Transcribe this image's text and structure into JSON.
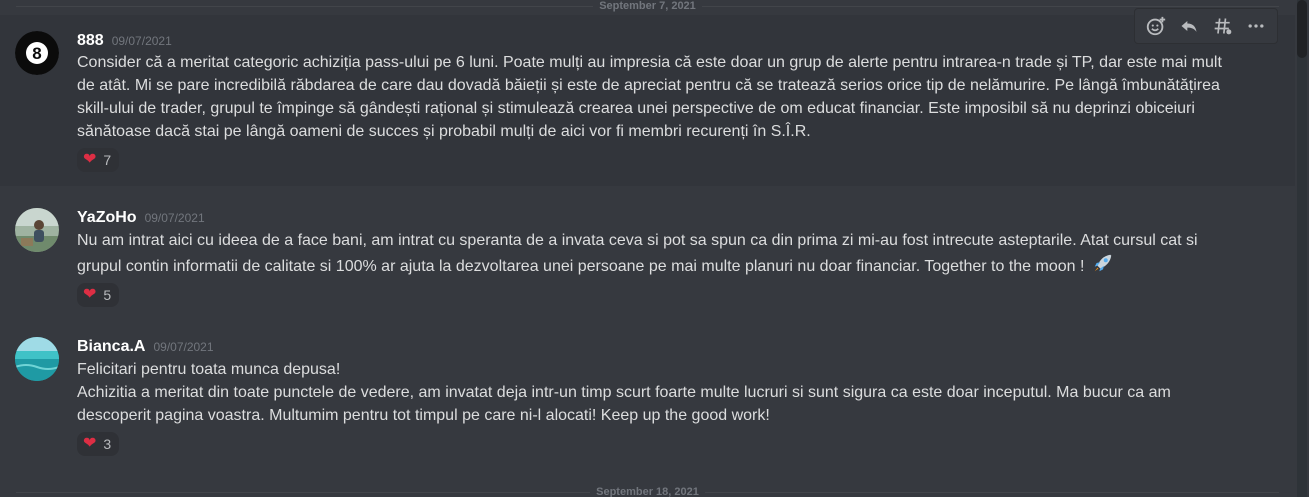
{
  "dividers": {
    "top": "September 7, 2021",
    "bottom": "September 18, 2021"
  },
  "toolbar": {
    "icons": [
      "add-reaction-icon",
      "reply-icon",
      "create-thread-icon",
      "more-icon"
    ]
  },
  "messages": [
    {
      "username": "888",
      "timestamp": "09/07/2021",
      "avatar": "eight-ball-icon",
      "lines": [
        "Consider că a meritat categoric achiziția pass-ului pe 6 luni. Poate mulți au impresia că este doar un grup de alerte pentru intrarea-n trade și TP, dar este mai mult de atât. Mi se pare incredibilă răbdarea de care dau dovadă băieții și este de apreciat pentru că se tratează serios orice tip de nelămurire. Pe lângă îmbunătățirea skill-ului de trader, grupul te împinge să gândești rațional și stimulează crearea unei perspective de om educat financiar. Este imposibil să nu deprinzi obiceiuri sănătoase dacă stai pe lângă oameni de succes și probabil mulți de aici vor fi membri recurenți în S.Î.R."
      ],
      "reaction": {
        "emoji": "❤",
        "count": "7"
      }
    },
    {
      "username": "YaZoHo",
      "timestamp": "09/07/2021",
      "avatar": "photo-avatar",
      "lines": [
        "Nu am intrat aici cu ideea de a face bani, am intrat cu speranta de a invata ceva si pot sa spun ca din prima zi mi-au fost intrecute asteptarile. Atat cursul cat si grupul contin informatii de calitate si 100% ar ajuta la dezvoltarea unei persoane pe mai multe planuri nu doar financiar. Together to the moon !"
      ],
      "reaction": {
        "emoji": "❤",
        "count": "5"
      }
    },
    {
      "username": "Bianca.A",
      "timestamp": "09/07/2021",
      "avatar": "sea-photo-avatar",
      "lines": [
        "Felicitari pentru toata munca depusa!",
        "Achizitia a meritat din toate punctele de vedere, am invatat deja intr-un timp scurt foarte multe lucruri si sunt sigura ca este doar inceputul. Ma bucur ca am descoperit pagina voastra. Multumim pentru tot timpul pe care ni-l alocati! Keep up the good work!"
      ],
      "reaction": {
        "emoji": "❤",
        "count": "3"
      }
    }
  ]
}
